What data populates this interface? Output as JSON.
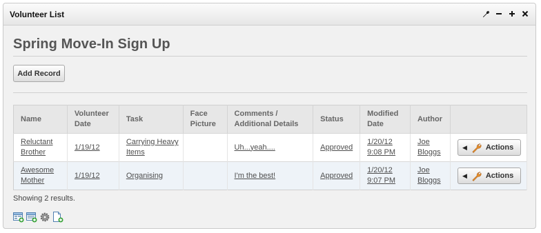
{
  "panel": {
    "title": "Volunteer List"
  },
  "window_icons": [
    "wrench-icon",
    "minimize-icon",
    "maximize-icon",
    "close-icon"
  ],
  "heading": "Spring Move-In Sign Up",
  "add_record_label": "Add Record",
  "table": {
    "headers": {
      "name": "Name",
      "volunteer_date": "Volunteer Date",
      "task": "Task",
      "face_picture": "Face Picture",
      "comments": "Comments / Additional Details",
      "status": "Status",
      "modified_date": "Modified Date",
      "author": "Author"
    },
    "rows": [
      {
        "name": "Reluctant Brother",
        "volunteer_date": "1/19/12",
        "task": "Carrying Heavy Items",
        "face_picture": "",
        "comments": "Uh...yeah....",
        "status": "Approved",
        "modified_date": "1/20/12 9:08 PM",
        "author": "Joe Bloggs",
        "actions_label": "Actions"
      },
      {
        "name": "Awesome Mother",
        "volunteer_date": "1/19/12",
        "task": "Organising",
        "face_picture": "",
        "comments": "I'm the best!",
        "status": "Approved",
        "modified_date": "1/20/12 9:07 PM",
        "author": "Joe Bloggs",
        "actions_label": "Actions"
      }
    ]
  },
  "summary": "Showing 2 results.",
  "toolbar_icons": [
    "add-form-icon",
    "add-list-icon",
    "settings-gear-icon",
    "add-page-icon"
  ],
  "colors": {
    "panel_bg": "#f1f1f1",
    "row_alt": "#eef3f8",
    "header_bg": "#e7e7e7"
  }
}
